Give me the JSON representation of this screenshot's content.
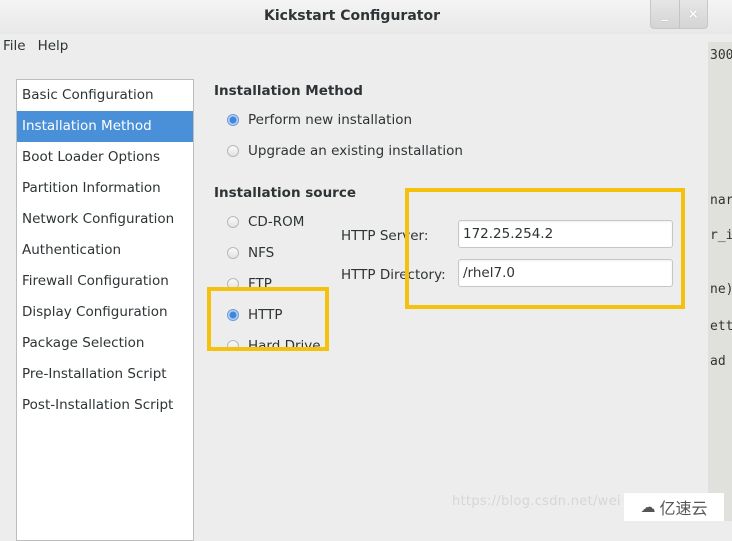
{
  "window": {
    "title": "Kickstart Configurator",
    "minimize_label": "_",
    "close_label": "×"
  },
  "menu": [
    "File",
    "Help"
  ],
  "sidebar": {
    "items": [
      {
        "label": "Basic Configuration",
        "active": false
      },
      {
        "label": "Installation Method",
        "active": true
      },
      {
        "label": "Boot Loader Options",
        "active": false
      },
      {
        "label": "Partition Information",
        "active": false
      },
      {
        "label": "Network Configuration",
        "active": false
      },
      {
        "label": "Authentication",
        "active": false
      },
      {
        "label": "Firewall Configuration",
        "active": false
      },
      {
        "label": "Display Configuration",
        "active": false
      },
      {
        "label": "Package Selection",
        "active": false
      },
      {
        "label": "Pre-Installation Script",
        "active": false
      },
      {
        "label": "Post-Installation Script",
        "active": false
      }
    ]
  },
  "installation_method": {
    "title": "Installation Method",
    "options": [
      {
        "label": "Perform new installation",
        "checked": true
      },
      {
        "label": "Upgrade an existing installation",
        "checked": false
      }
    ]
  },
  "installation_source": {
    "title": "Installation source",
    "options": [
      {
        "label": "CD-ROM",
        "checked": false
      },
      {
        "label": "NFS",
        "checked": false
      },
      {
        "label": "FTP",
        "checked": false
      },
      {
        "label": "HTTP",
        "checked": true
      },
      {
        "label": "Hard Drive",
        "checked": false
      }
    ],
    "http_server_label": "HTTP Server:",
    "http_server_value": "172.25.254.2",
    "http_directory_label": "HTTP Directory:",
    "http_directory_value": "/rhel7.0"
  },
  "background_terminal": {
    "lines": [
      "300",
      "nar",
      "r_i",
      "ne)",
      "ett",
      "ad"
    ]
  },
  "annotation_color": "#f4c20d",
  "accent_color": "#4a90d9",
  "watermark": {
    "url_text": "https://blog.csdn.net/wei",
    "logo_text": "亿速云"
  }
}
